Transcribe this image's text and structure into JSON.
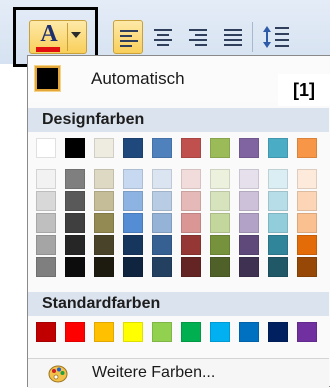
{
  "toolbar": {
    "font_color_letter": "A",
    "font_color_underline": "#e01010",
    "buttons": [
      {
        "name": "align-left",
        "active": true
      },
      {
        "name": "align-center",
        "active": false
      },
      {
        "name": "align-right",
        "active": false
      },
      {
        "name": "justify",
        "active": false
      }
    ]
  },
  "dropdown": {
    "automatic": {
      "label": "Automatisch",
      "swatch": "#000000"
    },
    "callout": "[1]",
    "theme_colors": {
      "header": "Designfarben",
      "base": [
        "#ffffff",
        "#000000",
        "#eeece1",
        "#1f497d",
        "#4f81bd",
        "#c0504d",
        "#9bbb59",
        "#8064a2",
        "#4bacc6",
        "#f79646"
      ],
      "shades": [
        [
          "#f2f2f2",
          "#7f7f7f",
          "#ddd9c3",
          "#c6d9f0",
          "#dbe5f1",
          "#f2dcdb",
          "#ebf1dd",
          "#e5e0ec",
          "#dbeef3",
          "#fdeada"
        ],
        [
          "#d8d8d8",
          "#595959",
          "#c4bd97",
          "#8db3e2",
          "#b8cce4",
          "#e5b9b7",
          "#d7e3bc",
          "#ccc1d9",
          "#b7dde8",
          "#fbd5b5"
        ],
        [
          "#bfbfbf",
          "#3f3f3f",
          "#938953",
          "#548dd4",
          "#95b3d7",
          "#d99694",
          "#c3d69b",
          "#b2a2c7",
          "#92cddc",
          "#fac08f"
        ],
        [
          "#a5a5a5",
          "#262626",
          "#494429",
          "#17365d",
          "#366092",
          "#953734",
          "#76923c",
          "#5f497a",
          "#31859b",
          "#e36c09"
        ],
        [
          "#7f7f7f",
          "#0c0c0c",
          "#1d1b10",
          "#0f243e",
          "#244061",
          "#632423",
          "#4f6128",
          "#3f3151",
          "#205867",
          "#974806"
        ]
      ]
    },
    "standard_colors": {
      "header": "Standardfarben",
      "colors": [
        "#c00000",
        "#ff0000",
        "#ffc000",
        "#ffff00",
        "#92d050",
        "#00b050",
        "#00b0f0",
        "#0070c0",
        "#002060",
        "#7030a0"
      ]
    },
    "more_colors": {
      "label": "Weitere Farben..."
    }
  }
}
